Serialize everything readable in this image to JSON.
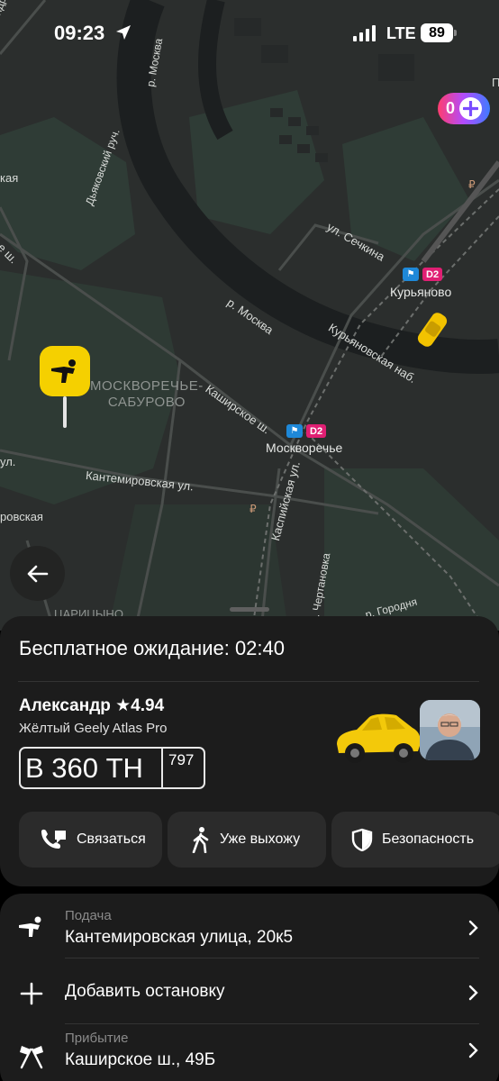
{
  "status_bar": {
    "time": "09:23",
    "network": "LTE",
    "battery": "89"
  },
  "map": {
    "labels": {
      "andropova": "пр. Андропова",
      "moskva_v": "р. Москва",
      "dyakovskiy": "Дьяковский руч.",
      "left_kaya": "кая",
      "left_sh": "ое ш.",
      "sechkina": "ул. Сечкина",
      "moskva_river": "р. Москва",
      "kuryanovskaya": "Курьяновская наб.",
      "district_line1": "МОСКВОРЕЧЬЕ-",
      "district_line2": "САБУРОВО",
      "kashirskoe": "Каширское ш.",
      "kantemirovskaya_ul": "Кантемировская ул.",
      "left_ul": "ул.",
      "left_rovskaya": "ровская",
      "kaspiyskaya": "Каспийская ул.",
      "chertanovka": "р. Чертановка",
      "gorodnya": "р. Городня",
      "tsaritsyno": "ЦАРИЦЫНО",
      "top_right_p": "П"
    },
    "stations": [
      {
        "name": "Курьяново",
        "line": "D2"
      },
      {
        "name": "Москворечье",
        "line": "D2"
      }
    ],
    "plus_points": "0",
    "ruble_icon": "₽"
  },
  "sheet": {
    "waiting_title": "Бесплатное ожидание: 02:40",
    "driver_name": "Александр ★4.94",
    "car_model": "Жёлтый Geely Atlas Pro",
    "plate_main": "В 360 ТН",
    "plate_region": "797",
    "actions": [
      {
        "label": "Связаться",
        "icon": "phone-chat-icon"
      },
      {
        "label": "Уже выхожу",
        "icon": "walking-person-icon"
      },
      {
        "label": "Безопасность",
        "icon": "shield-icon"
      }
    ]
  },
  "route": {
    "pickup": {
      "label": "Подача",
      "address": "Кантемировская улица, 20к5",
      "icon": "pickup-hand-icon"
    },
    "add_stop": {
      "label": "Добавить остановку",
      "icon": "plus-icon"
    },
    "arrival": {
      "label": "Прибытие",
      "address": "Каширское ш., 49Б",
      "icon": "finish-flags-icon"
    }
  },
  "colors": {
    "pin_yellow": "#f5d000",
    "sheet_bg": "#1c1c1c",
    "button_bg": "#2b2b2b",
    "metro_blue": "#1e88d8",
    "d2_pink": "#e01f73"
  }
}
